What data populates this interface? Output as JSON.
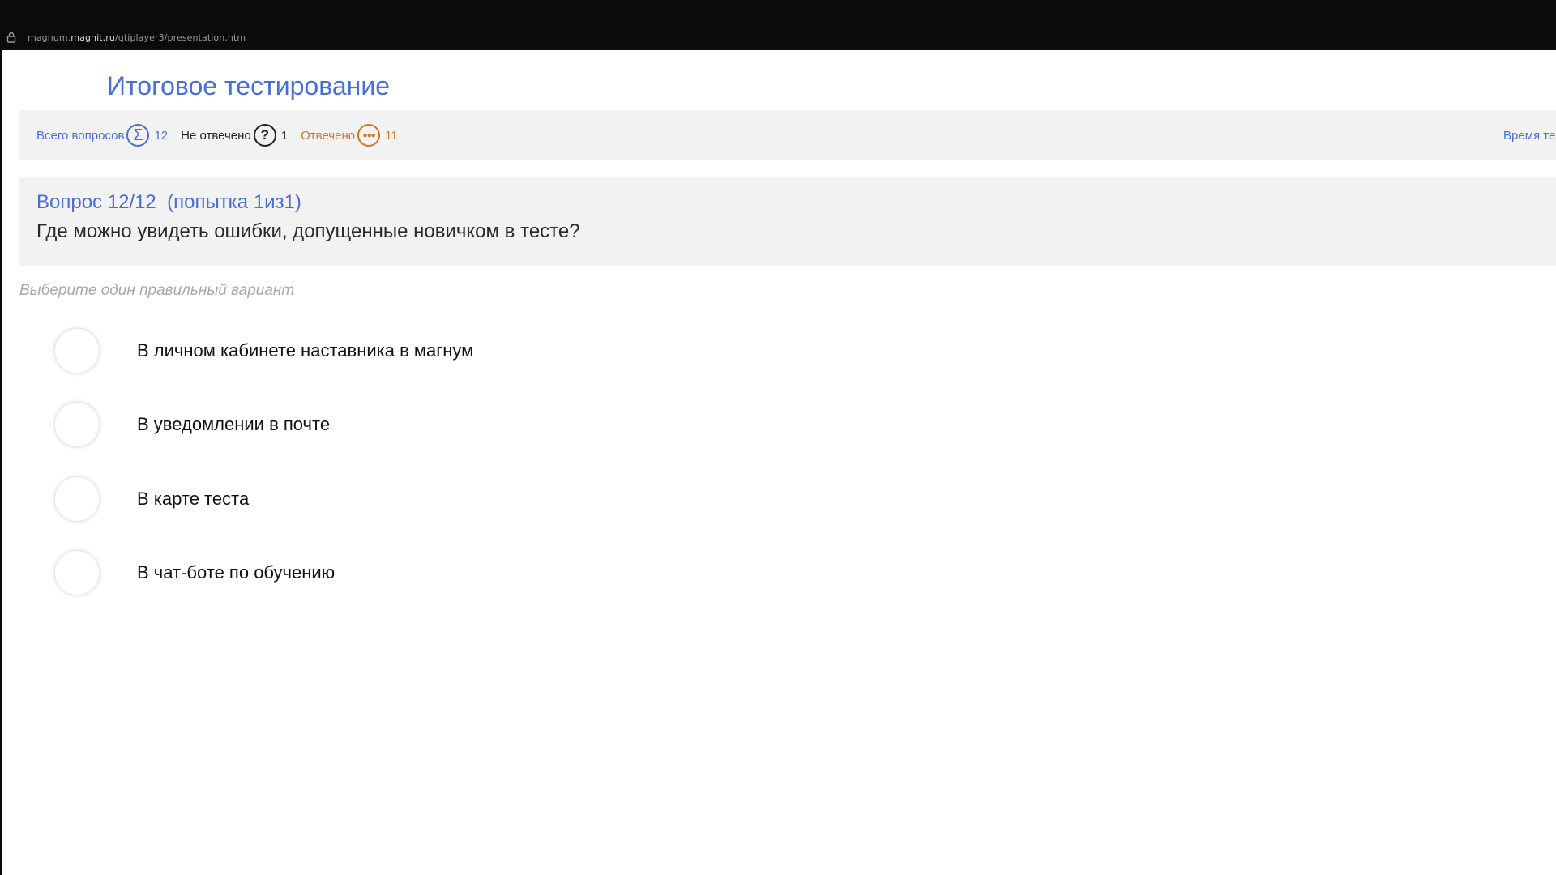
{
  "browser": {
    "url_prefix": "magnum.",
    "url_domain": "magnit.ru",
    "url_path": "/qtiplayer3/presentation.htm"
  },
  "page_title": "Итоговое тестирование",
  "stats": {
    "total_label": "Всего вопросов",
    "total_icon": "sigma-icon",
    "total_value": "12",
    "unanswered_label": "Не отвечено",
    "unanswered_icon": "question-icon",
    "unanswered_value": "1",
    "answered_label": "Отвечено",
    "answered_icon": "ellipsis-icon",
    "answered_value": "11",
    "time_label": "Время те"
  },
  "question": {
    "number": "Вопрос 12/12  (попытка 1из1)",
    "text": "Где можно увидеть ошибки, допущенные новичком в тесте?"
  },
  "hint": "Выберите один правильный вариант",
  "options": [
    {
      "label": "В личном кабинете наставника в магнум",
      "selected": false
    },
    {
      "label": "В уведомлении в почте",
      "selected": false
    },
    {
      "label": "В карте теста",
      "selected": false
    },
    {
      "label": "В чат-боте по обучению",
      "selected": false
    }
  ],
  "colors": {
    "accent": "#4a6fd1",
    "answered": "#c77a2a",
    "panel": "#f2f2f2"
  }
}
